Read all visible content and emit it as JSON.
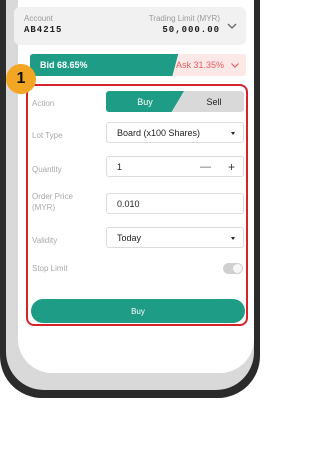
{
  "account": {
    "label": "Account",
    "value": "AB4215",
    "limit_label": "Trading Limit (MYR)",
    "limit_value": "50,000.00"
  },
  "market": {
    "bid_text": "Bid 68.65%",
    "ask_text": "Ask 31.35%",
    "bid_percent": 68.65
  },
  "badge": {
    "number": "1"
  },
  "form": {
    "action_label": "Action",
    "buy_tab": "Buy",
    "sell_tab": "Sell",
    "lot_type_label": "Lot Type",
    "lot_type_value": "Board (x100 Shares)",
    "quantity_label": "Quantity",
    "quantity_value": "1",
    "order_price_label": "Order Price (MYR)",
    "order_price_value": "0.010",
    "validity_label": "Validity",
    "validity_value": "Today",
    "stop_limit_label": "Stop Limit",
    "stop_limit_enabled": false,
    "submit_label": "Buy"
  },
  "colors": {
    "accent": "#1f9c86",
    "ask": "#e35d5d",
    "highlight": "#d4232a",
    "badge": "#f2a623"
  },
  "icons": {
    "account_chevron": "chevron-down-icon",
    "ask_chevron": "chevron-down-icon",
    "dropdown": "caret-down-icon"
  }
}
